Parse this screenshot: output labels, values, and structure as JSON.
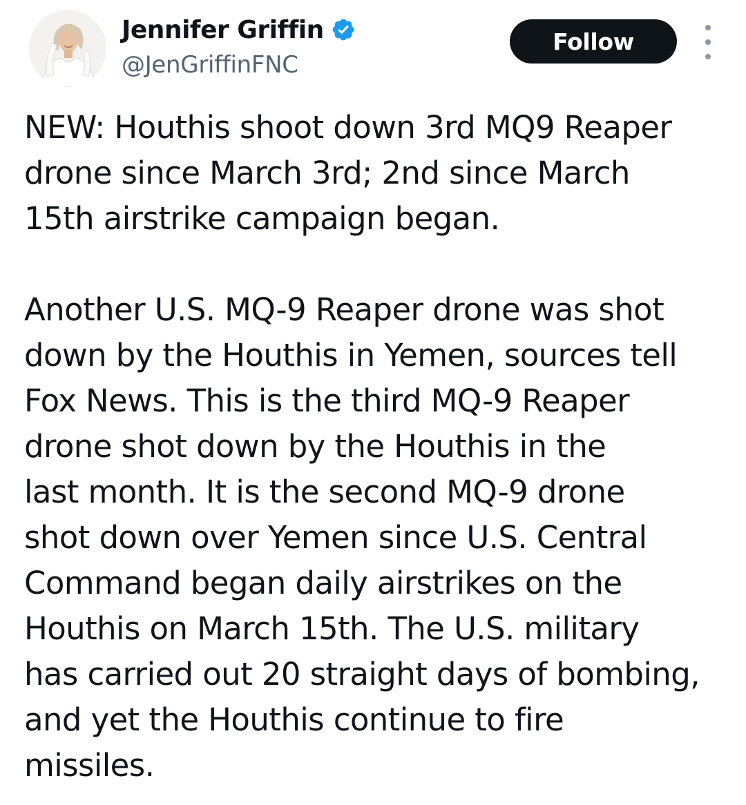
{
  "author": {
    "display_name": "Jennifer Griffin",
    "handle": "@JenGriffinFNC",
    "verified_icon": "verified-badge-icon",
    "accent_color": "#1d9bf0"
  },
  "actions": {
    "follow_label": "Follow",
    "more_icon": "more-options-icon"
  },
  "tweet": {
    "paragraphs": [
      {
        "lines": [
          "NEW: Houthis shoot down 3rd MQ9 Reaper",
          "drone since March 3rd; 2nd since March",
          "15th airstrike campaign began."
        ]
      },
      {
        "lines": [
          "Another U.S. MQ-9 Reaper drone was shot",
          "down by the Houthis in Yemen, sources tell",
          "Fox News. This is the third MQ-9 Reaper",
          "drone shot down by the Houthis in the",
          "last month. It is the second MQ-9 drone",
          "shot down over Yemen since U.S. Central",
          "Command began daily airstrikes on the",
          "Houthis on March 15th. The U.S. military",
          "has carried out 20 straight days of bombing,",
          "and yet the Houthis continue to fire",
          "missiles."
        ]
      }
    ]
  }
}
